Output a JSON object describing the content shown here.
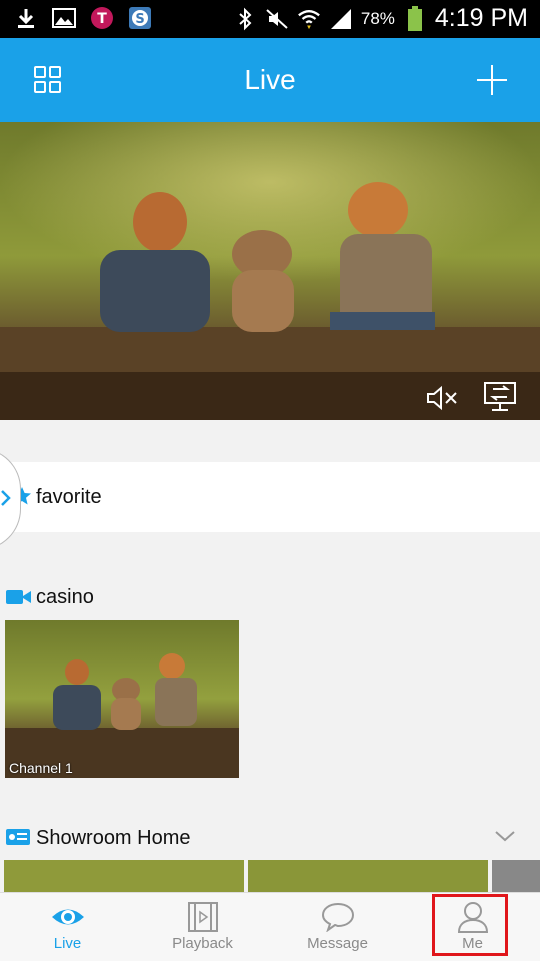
{
  "status_bar": {
    "battery_percent": "78%",
    "time": "4:19 PM",
    "icons": [
      "download-icon",
      "gallery-icon",
      "tmobile-icon",
      "app-s-icon",
      "bluetooth-icon",
      "mute-icon",
      "wifi-icon",
      "signal-icon",
      "battery-icon"
    ]
  },
  "header": {
    "title": "Live",
    "left_icon": "grid-layout-icon",
    "right_icon": "add-icon",
    "color": "#1aa1e8"
  },
  "video_controls": {
    "mute_icon": "speaker-mute-icon",
    "screen_icon": "screen-switch-icon"
  },
  "favorites": {
    "label": "favorite",
    "icon": "star-icon"
  },
  "groups": [
    {
      "name": "casino",
      "icon": "camera-icon",
      "thumbnails": [
        {
          "label": "Channel 1"
        }
      ]
    },
    {
      "name": "Showroom Home",
      "icon": "dvr-icon",
      "expand_icon": "chevron-down-icon"
    }
  ],
  "tabs": [
    {
      "label": "Live",
      "icon": "eye-icon",
      "active": true
    },
    {
      "label": "Playback",
      "icon": "film-icon",
      "active": false
    },
    {
      "label": "Message",
      "icon": "message-icon",
      "active": false
    },
    {
      "label": "Me",
      "icon": "person-icon",
      "active": false
    }
  ],
  "colors": {
    "accent": "#1aa1e8",
    "highlight": "#e0161b"
  }
}
